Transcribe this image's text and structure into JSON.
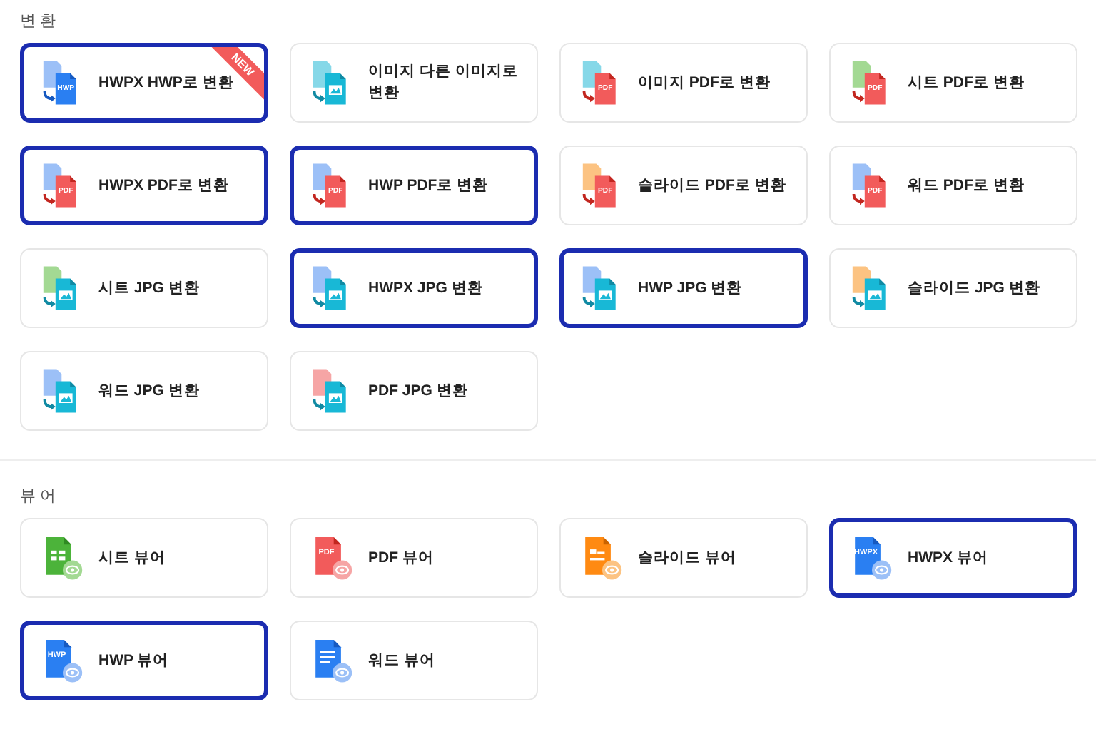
{
  "sections": [
    {
      "title": "변 환",
      "kind": "convert",
      "items": [
        {
          "label": "HWPX HWP로 변환",
          "selected": true,
          "from": {
            "kind": "hwpx"
          },
          "to": {
            "kind": "hwp",
            "text": "HWP"
          },
          "badge": "NEW"
        },
        {
          "label": "이미지 다른 이미지로 변환",
          "selected": false,
          "from": {
            "kind": "image"
          },
          "to": {
            "kind": "image"
          }
        },
        {
          "label": "이미지 PDF로 변환",
          "selected": false,
          "from": {
            "kind": "image"
          },
          "to": {
            "kind": "pdf",
            "text": "PDF"
          }
        },
        {
          "label": "시트 PDF로 변환",
          "selected": false,
          "from": {
            "kind": "sheet"
          },
          "to": {
            "kind": "pdf",
            "text": "PDF"
          }
        },
        {
          "label": "HWPX PDF로 변환",
          "selected": true,
          "from": {
            "kind": "hwpx"
          },
          "to": {
            "kind": "pdf",
            "text": "PDF"
          }
        },
        {
          "label": "HWP PDF로 변환",
          "selected": true,
          "from": {
            "kind": "hwp"
          },
          "to": {
            "kind": "pdf",
            "text": "PDF"
          }
        },
        {
          "label": "슬라이드 PDF로 변환",
          "selected": false,
          "from": {
            "kind": "slide"
          },
          "to": {
            "kind": "pdf",
            "text": "PDF"
          }
        },
        {
          "label": "워드 PDF로 변환",
          "selected": false,
          "from": {
            "kind": "word"
          },
          "to": {
            "kind": "pdf",
            "text": "PDF"
          }
        },
        {
          "label": "시트 JPG 변환",
          "selected": false,
          "from": {
            "kind": "sheet"
          },
          "to": {
            "kind": "image"
          }
        },
        {
          "label": "HWPX JPG 변환",
          "selected": true,
          "from": {
            "kind": "hwpx"
          },
          "to": {
            "kind": "image"
          }
        },
        {
          "label": "HWP JPG 변환",
          "selected": true,
          "from": {
            "kind": "hwp"
          },
          "to": {
            "kind": "image"
          }
        },
        {
          "label": "슬라이드 JPG 변환",
          "selected": false,
          "from": {
            "kind": "slide"
          },
          "to": {
            "kind": "image"
          }
        },
        {
          "label": "워드 JPG 변환",
          "selected": false,
          "from": {
            "kind": "word"
          },
          "to": {
            "kind": "image"
          }
        },
        {
          "label": "PDF JPG 변환",
          "selected": false,
          "from": {
            "kind": "pdf"
          },
          "to": {
            "kind": "image"
          }
        }
      ]
    },
    {
      "title": "뷰 어",
      "kind": "viewer",
      "items": [
        {
          "label": "시트 뷰어",
          "selected": false,
          "kind": "sheet"
        },
        {
          "label": "PDF 뷰어",
          "selected": false,
          "kind": "pdf",
          "icon_text": "PDF"
        },
        {
          "label": "슬라이드 뷰어",
          "selected": false,
          "kind": "slide"
        },
        {
          "label": "HWPX 뷰어",
          "selected": true,
          "kind": "hwpx",
          "icon_text": "HWPX"
        },
        {
          "label": "HWP 뷰어",
          "selected": true,
          "kind": "hwp",
          "icon_text": "HWP"
        },
        {
          "label": "워드 뷰어",
          "selected": false,
          "kind": "word"
        }
      ]
    }
  ]
}
